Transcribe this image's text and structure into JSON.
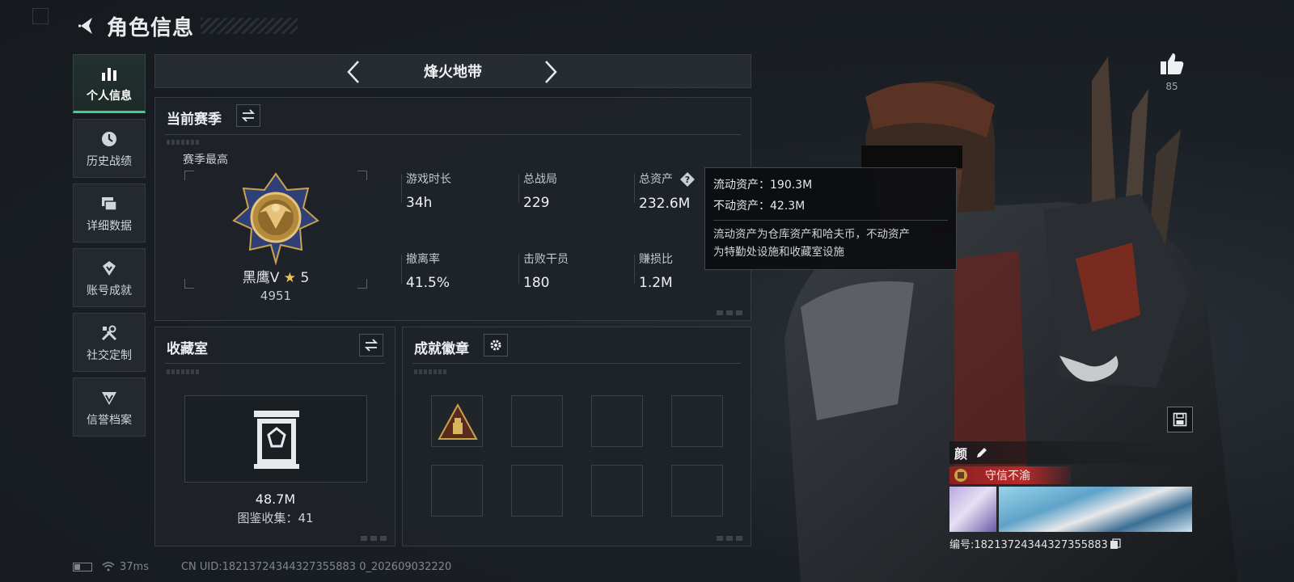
{
  "header": {
    "title": "角色信息"
  },
  "sidebar": {
    "items": [
      {
        "label": "个人信息",
        "icon": "bar-chart-icon",
        "active": true
      },
      {
        "label": "历史战绩",
        "icon": "clock-icon",
        "active": false
      },
      {
        "label": "详细数据",
        "icon": "cards-icon",
        "active": false
      },
      {
        "label": "账号成就",
        "icon": "achievement-icon",
        "active": false
      },
      {
        "label": "社交定制",
        "icon": "tools-icon",
        "active": false
      },
      {
        "label": "信誉档案",
        "icon": "shield-icon",
        "active": false
      }
    ]
  },
  "mode": {
    "name": "烽火地带"
  },
  "season": {
    "title": "当前赛季",
    "best_label": "赛季最高",
    "rank_name": "黑鹰Ⅴ",
    "rank_stars": "5",
    "rank_score": "4951",
    "stats": [
      {
        "key": "游戏时长",
        "value": "34h"
      },
      {
        "key": "总战局",
        "value": "229"
      },
      {
        "key": "总资产",
        "value": "232.6M"
      },
      {
        "key": "撤离率",
        "value": "41.5%"
      },
      {
        "key": "击败干员",
        "value": "180"
      },
      {
        "key": "赚损比",
        "value": "1.2M"
      }
    ]
  },
  "tooltip": {
    "liquid": "流动资产：190.3M",
    "fixed": "不动资产：42.3M",
    "desc_line1": "流动资产为仓库资产和哈夫币，不动资产",
    "desc_line2": "为特勤处设施和收藏室设施"
  },
  "vault": {
    "title": "收藏室",
    "value": "48.7M",
    "collection": "图鉴收集：41"
  },
  "badges": {
    "title": "成就徽章",
    "slots": 8
  },
  "profile": {
    "likes": "85",
    "name": "颜",
    "title_badge": "守信不渝",
    "serial": "编号:18213724344327355883"
  },
  "status": {
    "ping": "37ms",
    "uid": "CN UID:18213724344327355883 0_202609032220"
  },
  "colors": {
    "accent": "#3ccf8e",
    "title_badge": "#b82a2a",
    "gold": "#c9a24a"
  }
}
